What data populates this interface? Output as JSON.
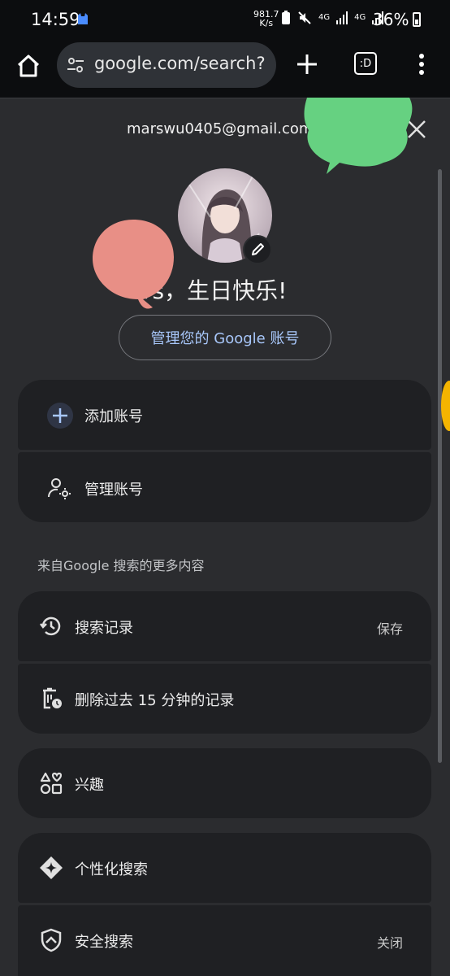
{
  "status_bar": {
    "time": "14:59",
    "rate_value": "981.7",
    "rate_unit": "K/s",
    "signal1": "4G",
    "signal2": "4G",
    "battery": "36%"
  },
  "toolbar": {
    "url": "google.com/search?",
    "tabs_label": ":D"
  },
  "account": {
    "email": "marswu0405@gmail.com",
    "greeting": "rs，生日快乐!",
    "manage_label": "管理您的 Google 账号"
  },
  "accounts": {
    "add_label": "添加账号",
    "manage_label": "管理账号"
  },
  "section": {
    "label": "来自Google 搜索的更多内容"
  },
  "items": {
    "history": {
      "label": "搜索记录",
      "value": "保存"
    },
    "delete15": {
      "label": "删除过去 15 分钟的记录"
    },
    "interests": {
      "label": "兴趣"
    },
    "personalized": {
      "label": "个性化搜索"
    },
    "safe_search": {
      "label": "安全搜索",
      "value": "关闭"
    }
  },
  "colors": {
    "accent": "#a8c7fa",
    "card": "#1f2023",
    "sheet": "#2b2c2f",
    "green_blob": "#66d181",
    "red_blob": "#e88f86",
    "yellow_blob": "#f4b400"
  },
  "icons": [
    "home-icon",
    "tune-icon",
    "plus-icon",
    "tab-switcher-icon",
    "more-vert-icon",
    "close-icon",
    "edit-pencil-icon",
    "person-gear-icon",
    "history-icon",
    "delete-clock-icon",
    "interests-shapes-icon",
    "sparkle-icon",
    "shield-icon"
  ]
}
